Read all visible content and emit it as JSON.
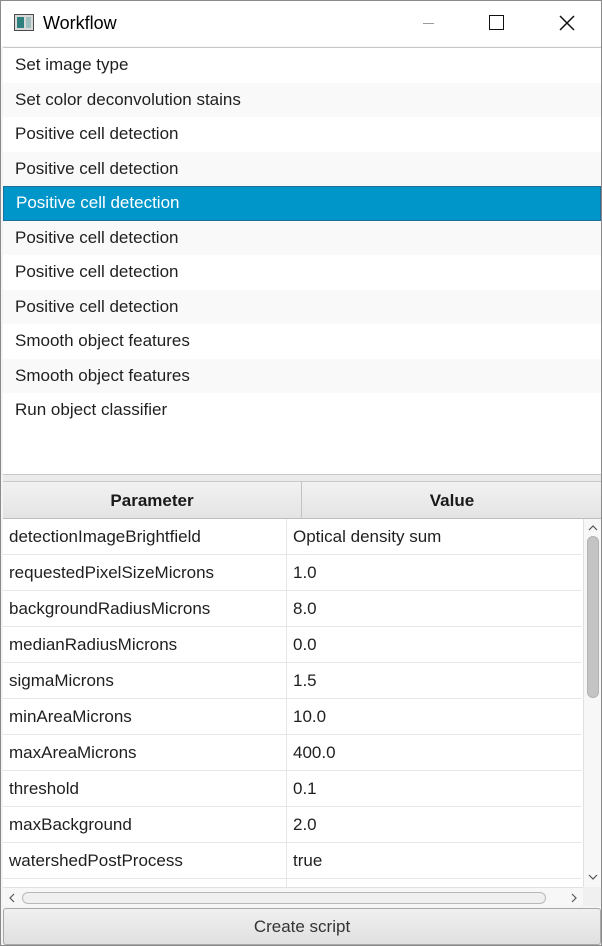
{
  "window": {
    "title": "Workflow"
  },
  "steps": [
    {
      "label": "Set image type",
      "selected": false
    },
    {
      "label": "Set color deconvolution stains",
      "selected": false
    },
    {
      "label": "Positive cell detection",
      "selected": false
    },
    {
      "label": "Positive cell detection",
      "selected": false
    },
    {
      "label": "Positive cell detection",
      "selected": true
    },
    {
      "label": "Positive cell detection",
      "selected": false
    },
    {
      "label": "Positive cell detection",
      "selected": false
    },
    {
      "label": "Positive cell detection",
      "selected": false
    },
    {
      "label": "Smooth object features",
      "selected": false
    },
    {
      "label": "Smooth object features",
      "selected": false
    },
    {
      "label": "Run object classifier",
      "selected": false
    }
  ],
  "table": {
    "headers": {
      "parameter": "Parameter",
      "value": "Value"
    },
    "rows": [
      {
        "parameter": "detectionImageBrightfield",
        "value": "Optical density sum"
      },
      {
        "parameter": "requestedPixelSizeMicrons",
        "value": "1.0"
      },
      {
        "parameter": "backgroundRadiusMicrons",
        "value": "8.0"
      },
      {
        "parameter": "medianRadiusMicrons",
        "value": "0.0"
      },
      {
        "parameter": "sigmaMicrons",
        "value": "1.5"
      },
      {
        "parameter": "minAreaMicrons",
        "value": "10.0"
      },
      {
        "parameter": "maxAreaMicrons",
        "value": "400.0"
      },
      {
        "parameter": "threshold",
        "value": "0.1"
      },
      {
        "parameter": "maxBackground",
        "value": "2.0"
      },
      {
        "parameter": "watershedPostProcess",
        "value": "true"
      },
      {
        "parameter": "",
        "value": ""
      }
    ]
  },
  "actions": {
    "create_script_label": "Create script"
  },
  "colors": {
    "selection": "#0096c9",
    "selection_text": "#ffffff"
  }
}
